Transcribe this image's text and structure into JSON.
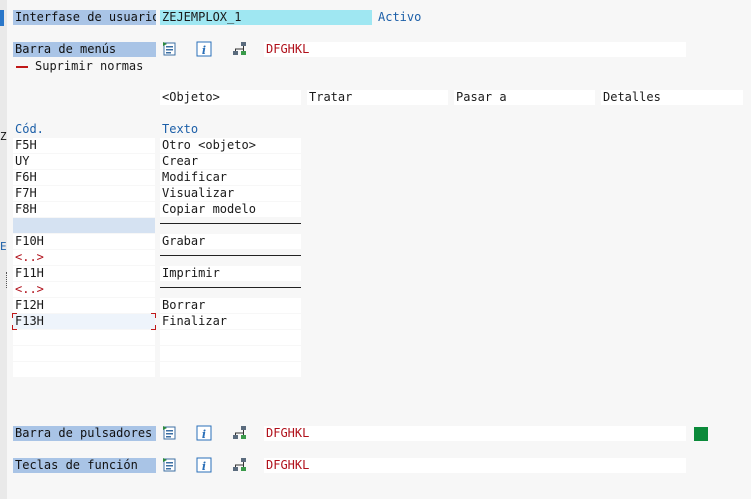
{
  "header": {
    "interface_label": "Interfase de usuario",
    "interface_value": "ZEJEMPLOX_1",
    "status": "Activo"
  },
  "menubar": {
    "label": "Barra de menús",
    "object_name": "DFGHKL",
    "suppress_norms": "Suprimir normas",
    "columns": [
      "<Objeto>",
      "Tratar",
      "Pasar a",
      "Detalles"
    ]
  },
  "table": {
    "col_code": "Cód.",
    "col_text": "Texto",
    "rows": [
      {
        "code": "F5H",
        "text": "Otro <objeto>"
      },
      {
        "code": "UY",
        "text": "Crear"
      },
      {
        "code": "F6H",
        "text": "Modificar"
      },
      {
        "code": "F7H",
        "text": "Visualizar"
      },
      {
        "code": "F8H",
        "text": "Copiar modelo"
      },
      {
        "code": "",
        "text": ""
      },
      {
        "code": "F10H",
        "text": "Grabar"
      },
      {
        "code": "<..>",
        "text": ""
      },
      {
        "code": "F11H",
        "text": "Imprimir"
      },
      {
        "code": "<..>",
        "text": ""
      },
      {
        "code": "F12H",
        "text": "Borrar"
      },
      {
        "code": "F13H",
        "text": "Finalizar"
      },
      {
        "code": "",
        "text": ""
      },
      {
        "code": "",
        "text": ""
      },
      {
        "code": "",
        "text": ""
      }
    ]
  },
  "pushbuttons": {
    "label": "Barra de pulsadores",
    "object_name": "DFGHKL"
  },
  "function_keys": {
    "label": "Teclas de función",
    "object_name": "DFGHKL"
  },
  "left_edge": {
    "z_char": "Z",
    "e_char": "E"
  },
  "icons": {
    "object_list": "object-list-icon",
    "info": "info-icon",
    "hierarchy": "hierarchy-icon"
  },
  "colors": {
    "label_bg": "#a9c4e6",
    "value_cyan": "#9fe7f2",
    "status_blue": "#1c5fa8",
    "object_red": "#b0101a",
    "green_indicator": "#0b8a3a"
  }
}
